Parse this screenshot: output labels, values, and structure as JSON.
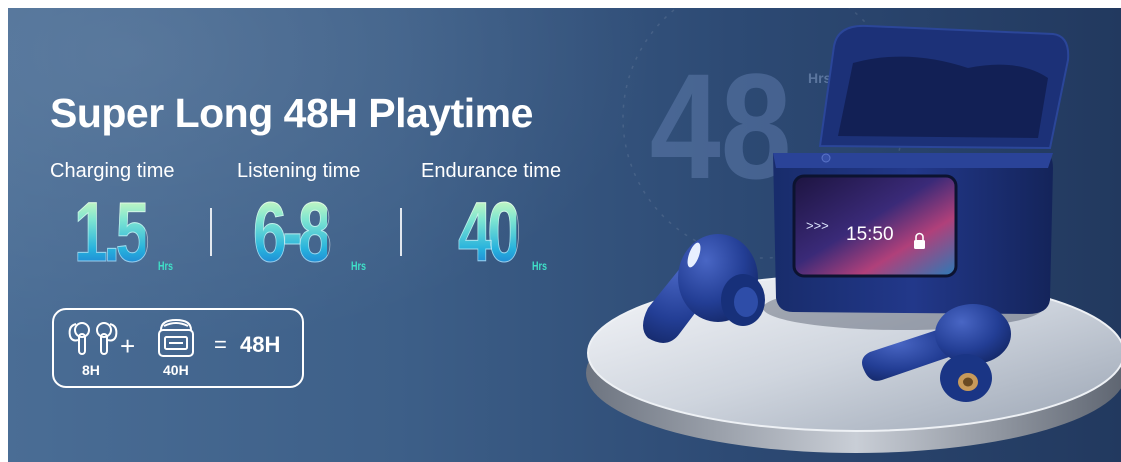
{
  "title": "Super Long 48H Playtime",
  "stats": [
    {
      "label": "Charging time",
      "value": "1.5",
      "unit": "Hrs"
    },
    {
      "label": "Listening time",
      "value": "6-8",
      "unit": "Hrs"
    },
    {
      "label": "Endurance time",
      "value": "40",
      "unit": "Hrs"
    }
  ],
  "summary": {
    "earbuds_hours": "8H",
    "case_hours": "40H",
    "plus": "+",
    "equals": "=",
    "total": "48H"
  },
  "background_numeral": "48",
  "background_numeral_unit": "Hrs",
  "screen": {
    "arrows": ">>>",
    "time": "15:50"
  },
  "colors": {
    "background_left": "#4a6d95",
    "background_right": "#22395f",
    "number_gradient_top": "#eaffb8",
    "number_gradient_bottom": "#1a6fd0",
    "earbud_blue": "#1f3a8c"
  }
}
